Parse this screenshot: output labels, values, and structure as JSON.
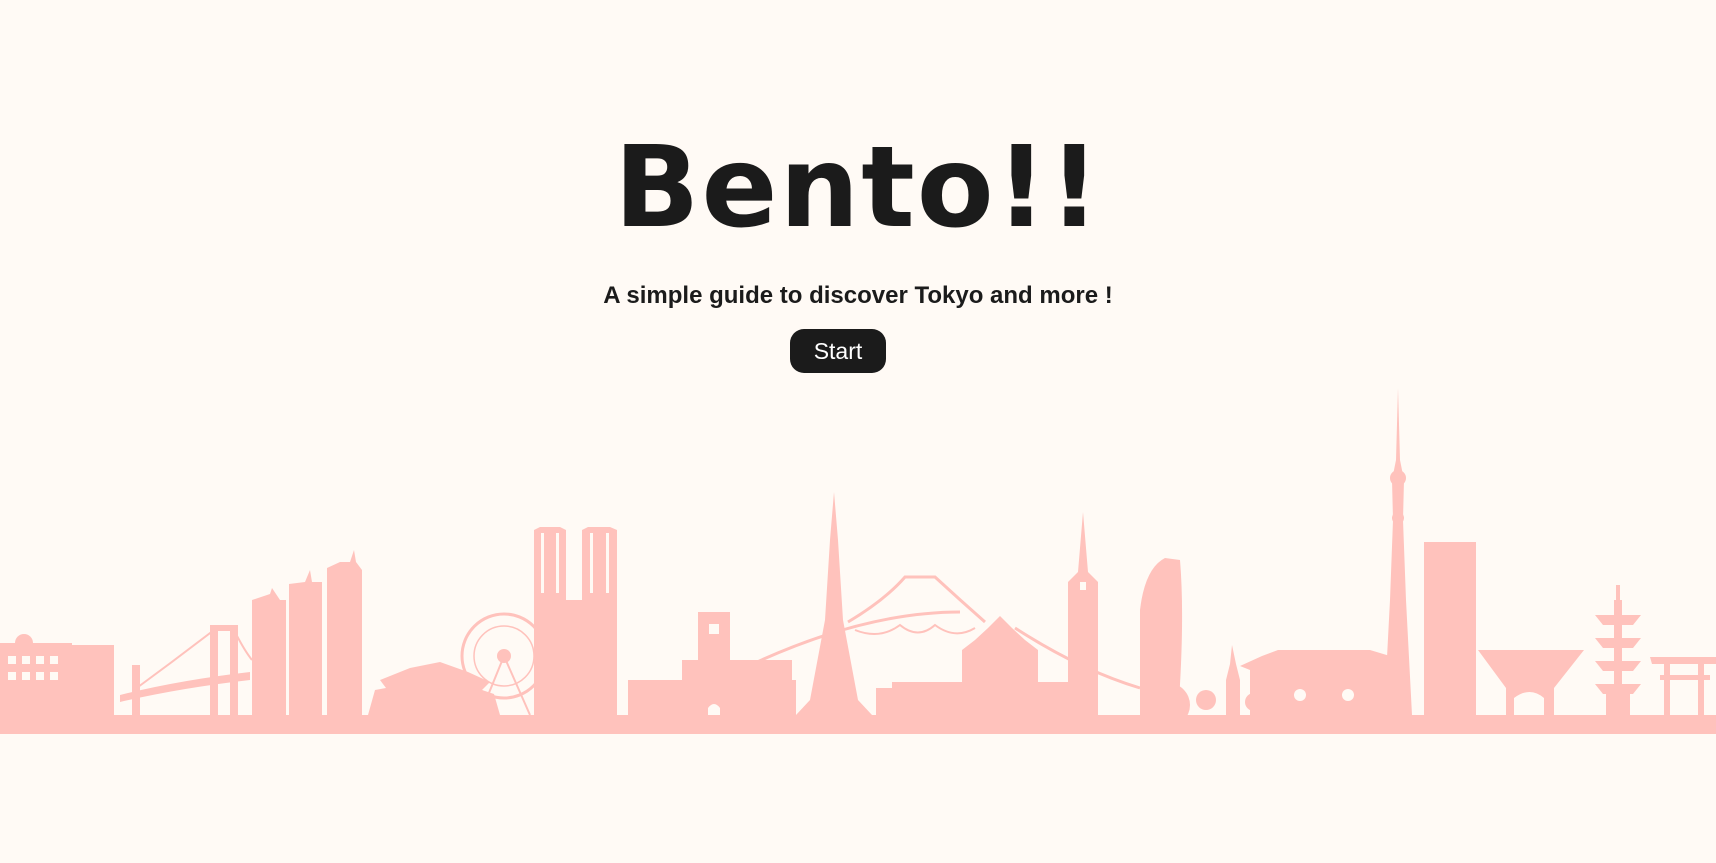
{
  "hero": {
    "title": "Bento!!",
    "subtitle": "A simple guide to discover Tokyo and more !",
    "start_label": "Start"
  },
  "skyline": {
    "illustration": "tokyo-skyline-silhouette",
    "color": "#ffc2bc"
  },
  "colors": {
    "background": "#fffaf5",
    "text": "#1b1b1b",
    "button_bg": "#1b1b1b",
    "button_text": "#ffffff",
    "accent": "#ffc2bc"
  }
}
